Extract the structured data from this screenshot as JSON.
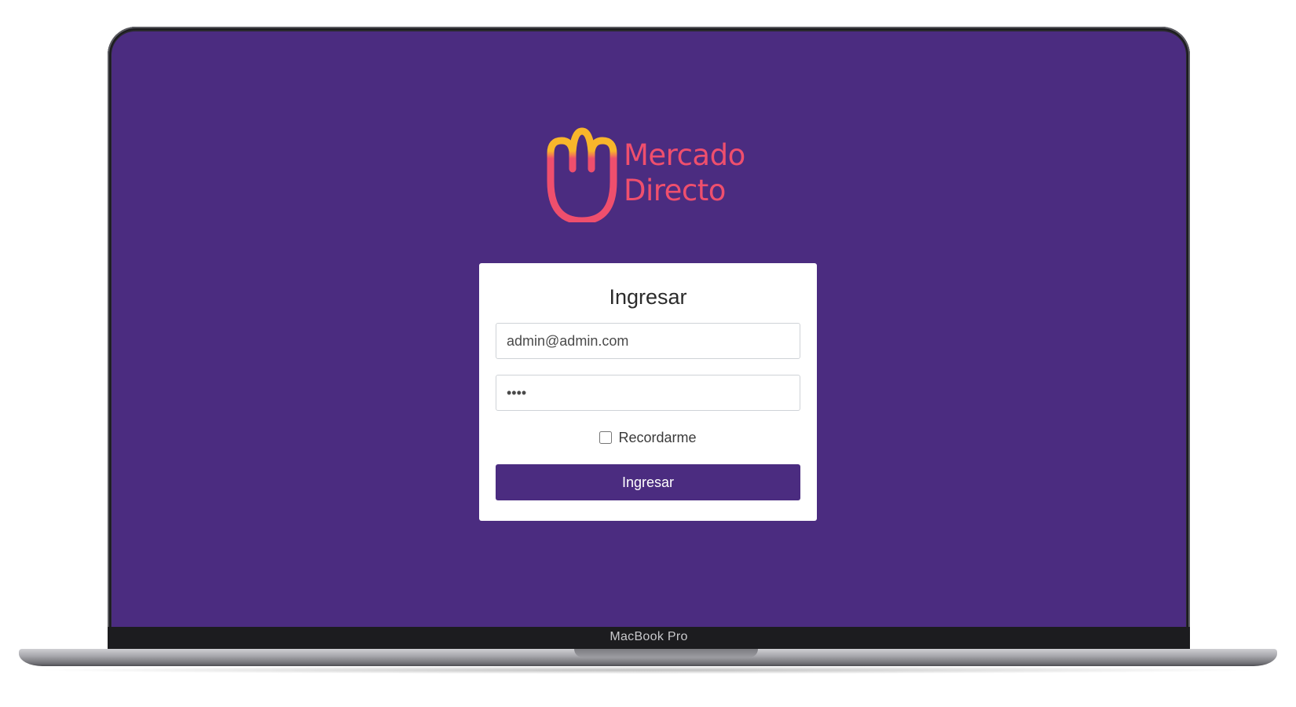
{
  "device": {
    "model_label": "MacBook Pro"
  },
  "colors": {
    "background": "#4b2c80",
    "accent": "#4b2c80",
    "brand_pink": "#ef4f6d",
    "brand_yellow": "#f8b62b"
  },
  "brand": {
    "line1": "Mercado",
    "line2": "Directo",
    "logo_icon": "shopping-bag-m-icon"
  },
  "login": {
    "title": "Ingresar",
    "email_value": "admin@admin.com",
    "password_value": "1234",
    "remember_label": "Recordarme",
    "remember_checked": false,
    "submit_label": "Ingresar"
  }
}
